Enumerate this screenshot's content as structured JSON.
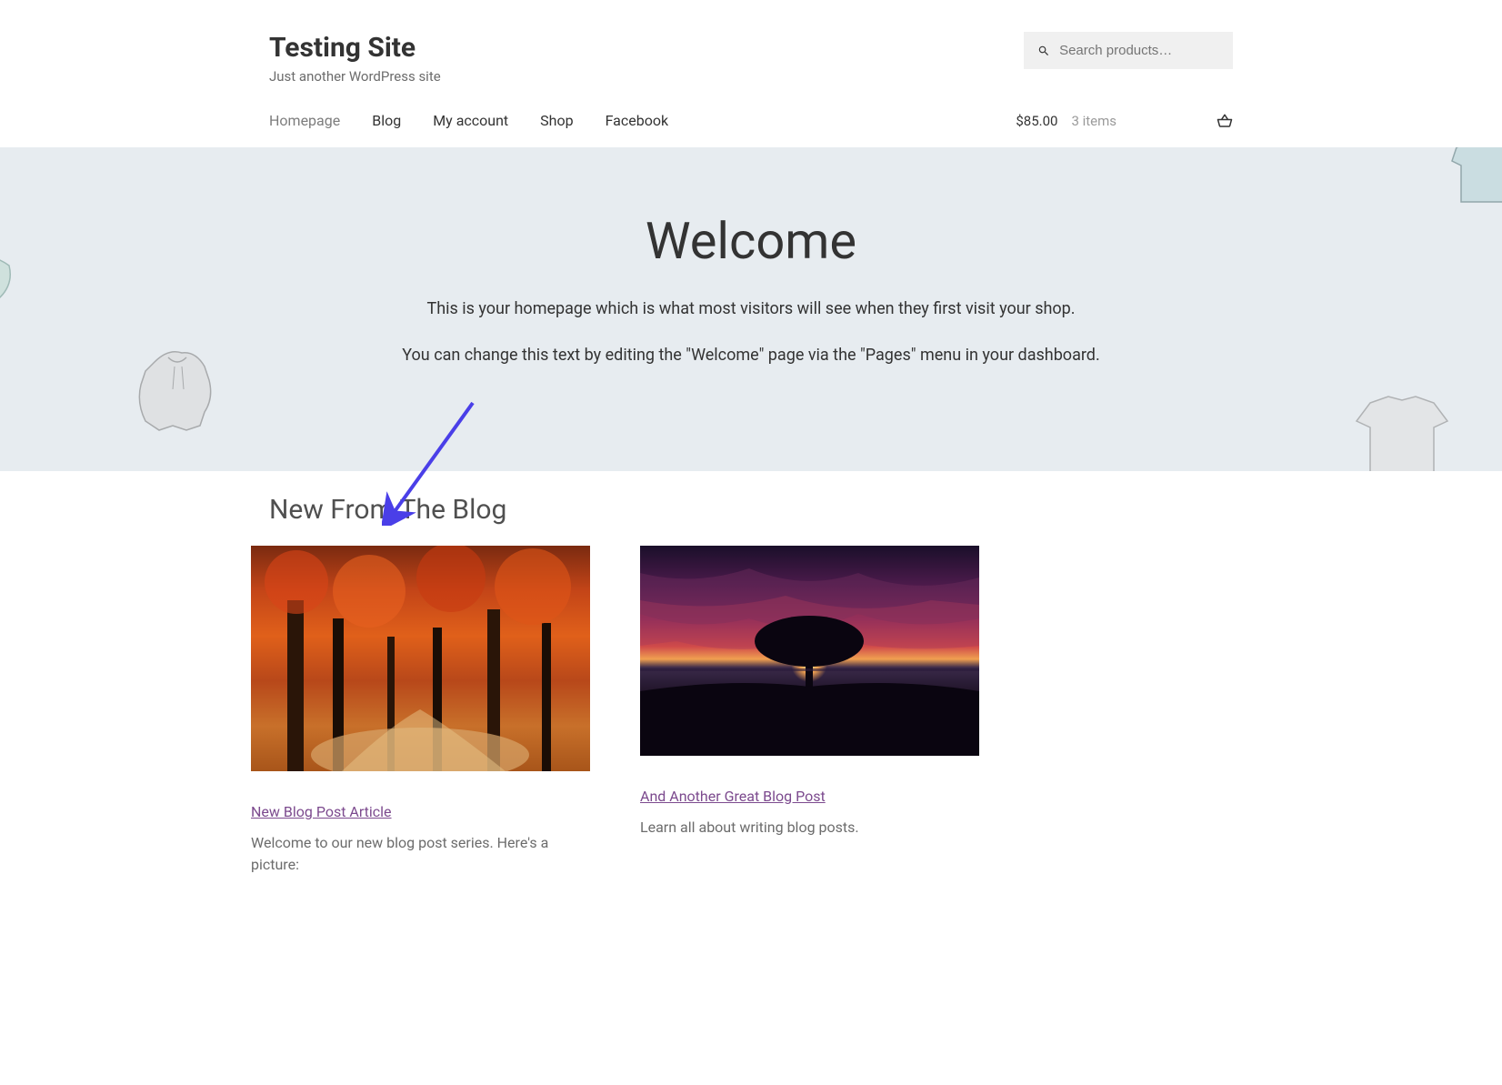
{
  "site": {
    "title": "Testing Site",
    "tagline": "Just another WordPress site"
  },
  "search": {
    "placeholder": "Search products…"
  },
  "nav": {
    "items": [
      {
        "label": "Homepage",
        "active": true
      },
      {
        "label": "Blog",
        "active": false
      },
      {
        "label": "My account",
        "active": false
      },
      {
        "label": "Shop",
        "active": false
      },
      {
        "label": "Facebook",
        "active": false
      }
    ]
  },
  "cart": {
    "total": "$85.00",
    "items_label": "3 items"
  },
  "hero": {
    "title": "Welcome",
    "line1": "This is your homepage which is what most visitors will see when they first visit your shop.",
    "line2": "You can change this text by editing the \"Welcome\" page via the \"Pages\" menu in your dashboard."
  },
  "blog": {
    "heading": "New From The Blog",
    "posts": [
      {
        "title": "New Blog Post Article",
        "excerpt": "Welcome to our new blog post series. Here's a picture:"
      },
      {
        "title": "And Another Great Blog Post",
        "excerpt": "Learn all about writing blog posts."
      }
    ]
  }
}
